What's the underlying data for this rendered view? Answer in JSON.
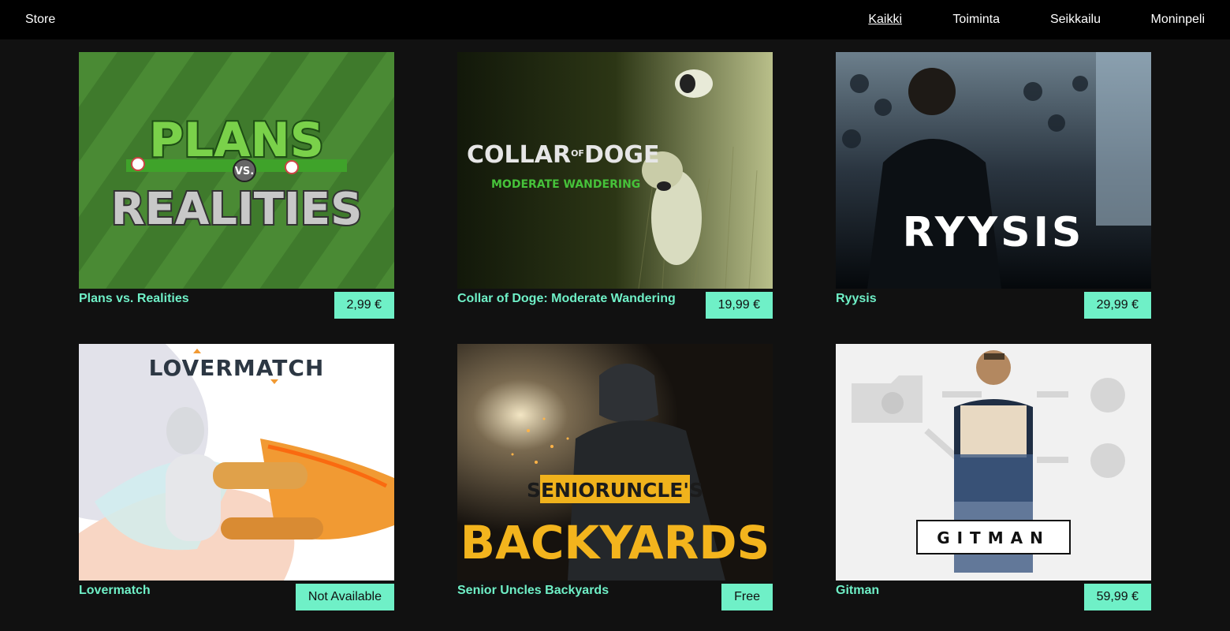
{
  "header": {
    "store_label": "Store",
    "nav": [
      "Kaikki",
      "Toiminta",
      "Seikkailu",
      "Moninpeli"
    ],
    "active_index": 0
  },
  "games": [
    {
      "title": "Plans vs. Realities",
      "price": "2,99 €",
      "art": {
        "line1": "PLANS",
        "vs": "VS.",
        "line2": "REALITIES"
      }
    },
    {
      "title": "Collar of Doge: Moderate Wandering",
      "price": "19,99 €",
      "art": {
        "main_left": "COLLAR",
        "of": "OF",
        "main_right": "DOGE",
        "subtitle": "MODERATE WANDERING"
      }
    },
    {
      "title": "Ryysis",
      "price": "29,99 €",
      "art": {
        "logo": "RYYSIS"
      }
    },
    {
      "title": "Lovermatch",
      "price": "Not Available",
      "art": {
        "logo": "LOVERMATCH"
      }
    },
    {
      "title": "Senior Uncles Backyards",
      "price": "Free",
      "art": {
        "line1": "SENIORUNCLE'S",
        "line2": "BACKYARDS"
      }
    },
    {
      "title": "Gitman",
      "price": "59,99 €",
      "art": {
        "logo": "GITMAN"
      }
    }
  ],
  "colors": {
    "accent": "#6ff0c7",
    "topbar": "#000000",
    "background": "#111111"
  }
}
